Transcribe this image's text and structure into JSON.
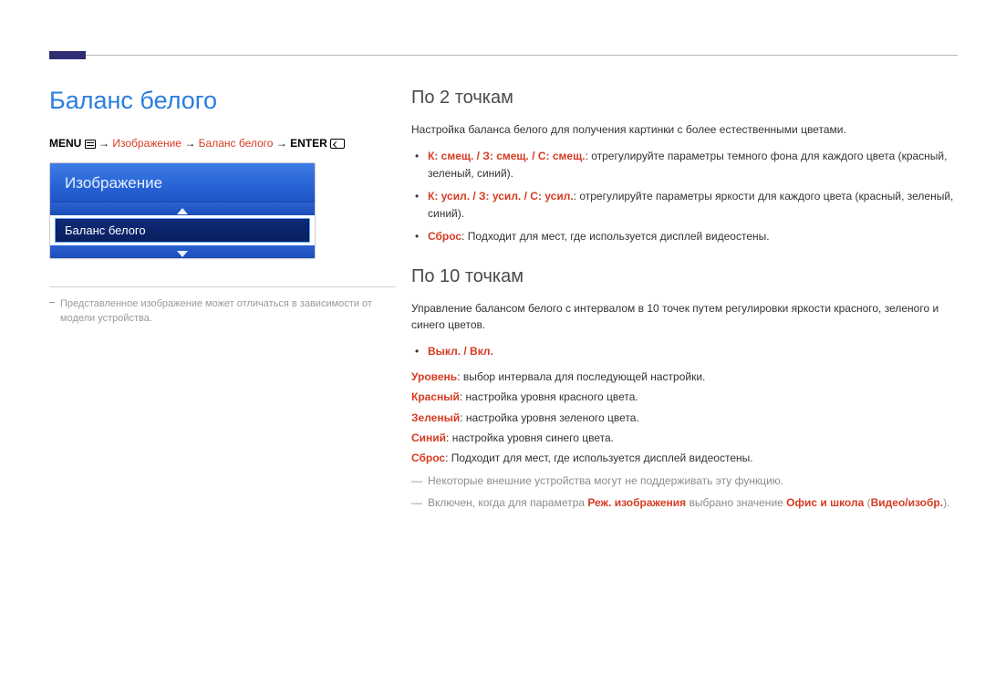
{
  "header": {
    "page_title": "Баланс белого"
  },
  "breadcrumb": {
    "menu": "MENU",
    "arrow": "→",
    "p1": "Изображение",
    "p2": "Баланс белого",
    "enter": "ENTER"
  },
  "osd": {
    "panel_title": "Изображение",
    "selected_item": "Баланс белого"
  },
  "left_note": "Представленное изображение может отличаться в зависимости от модели устройства.",
  "section1": {
    "title": "По 2 точкам",
    "intro": "Настройка баланса белого для получения картинки с более естественными цветами.",
    "b1_key": "К: смещ. / З: смещ. / С: смещ.",
    "b1_text": ": отрегулируйте параметры темного фона для каждого цвета (красный, зеленый, синий).",
    "b2_key": "К: усил. / З: усил. / С: усил.",
    "b2_text": ": отрегулируйте параметры яркости для каждого цвета (красный, зеленый, синий).",
    "b3_key": "Сброс",
    "b3_text": ": Подходит для мест, где используется дисплей видеостены."
  },
  "section2": {
    "title": "По 10 точкам",
    "intro": "Управление балансом белого с интервалом в 10 точек путем регулировки яркости красного, зеленого и синего цветов.",
    "toggle": "Выкл. / Вкл.",
    "l_level_k": "Уровень",
    "l_level_t": ": выбор интервала для последующей настройки.",
    "l_red_k": "Красный",
    "l_red_t": ": настройка уровня красного цвета.",
    "l_green_k": "Зеленый",
    "l_green_t": ": настройка уровня зеленого цвета.",
    "l_blue_k": "Синий",
    "l_blue_t": ": настройка уровня синего цвета.",
    "l_reset_k": "Сброс",
    "l_reset_t": ": Подходит для мест, где используется дисплей видеостены.",
    "note1": "Некоторые внешние устройства могут не поддерживать эту функцию.",
    "note2_a": "Включен, когда для параметра ",
    "note2_b": "Реж. изображения",
    "note2_c": " выбрано значение ",
    "note2_d": "Офис и школа",
    "note2_e": " (",
    "note2_f": "Видео/изобр.",
    "note2_g": ")."
  }
}
